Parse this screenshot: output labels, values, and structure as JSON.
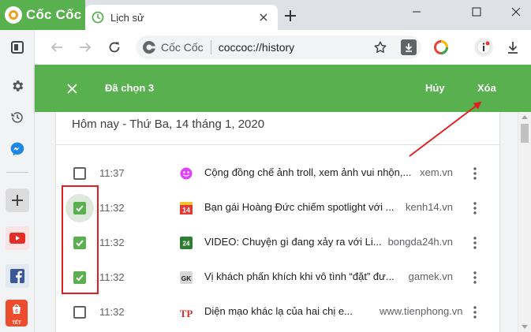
{
  "brand": {
    "name": "Cốc Cốc"
  },
  "tab": {
    "title": "Lịch sử"
  },
  "window_controls": {
    "minimize": "–",
    "maximize": "□",
    "close": "✕"
  },
  "address": {
    "site_label": "Cốc Cốc",
    "url": "coccoc://history"
  },
  "selection_bar": {
    "count_label": "Đã chọn 3",
    "cancel_label": "Hủy",
    "delete_label": "Xóa"
  },
  "history": {
    "date_header": "Hôm nay - Thứ Ba, 14 tháng 1, 2020",
    "items": [
      {
        "time": "11:37",
        "title": "Cộng đồng chế ảnh troll, xem ảnh vui nhộn,...",
        "domain": "xem.vn",
        "checked": false,
        "favicon": "xem-icon"
      },
      {
        "time": "11:32",
        "title": "Bạn gái Hoàng Đức chiếm spotlight với ...",
        "domain": "kenh14.vn",
        "checked": true,
        "favicon": "kenh14-icon"
      },
      {
        "time": "11:32",
        "title": "VIDEO: Chuyện gì đang xảy ra với Li...",
        "domain": "bongda24h.vn",
        "checked": true,
        "favicon": "bongda24h-icon"
      },
      {
        "time": "11:32",
        "title": "Vị khách phấn khích khi vô tình “đặt” đư...",
        "domain": "gamek.vn",
        "checked": true,
        "favicon": "gamek-icon"
      },
      {
        "time": "11:32",
        "title": "Diện mạo khác lạ của hai chị e...",
        "domain": "www.tienphong.vn",
        "checked": false,
        "favicon": "tienphong-icon"
      }
    ]
  },
  "favicon_labels": {
    "kenh14": "14",
    "bongda24h": "24",
    "gamek": "GK",
    "tienphong": "TP"
  },
  "sidebar": {
    "shopee_label": "TẾT"
  },
  "colors": {
    "accent_green": "#59b04f",
    "annotation_red": "#e02020"
  }
}
